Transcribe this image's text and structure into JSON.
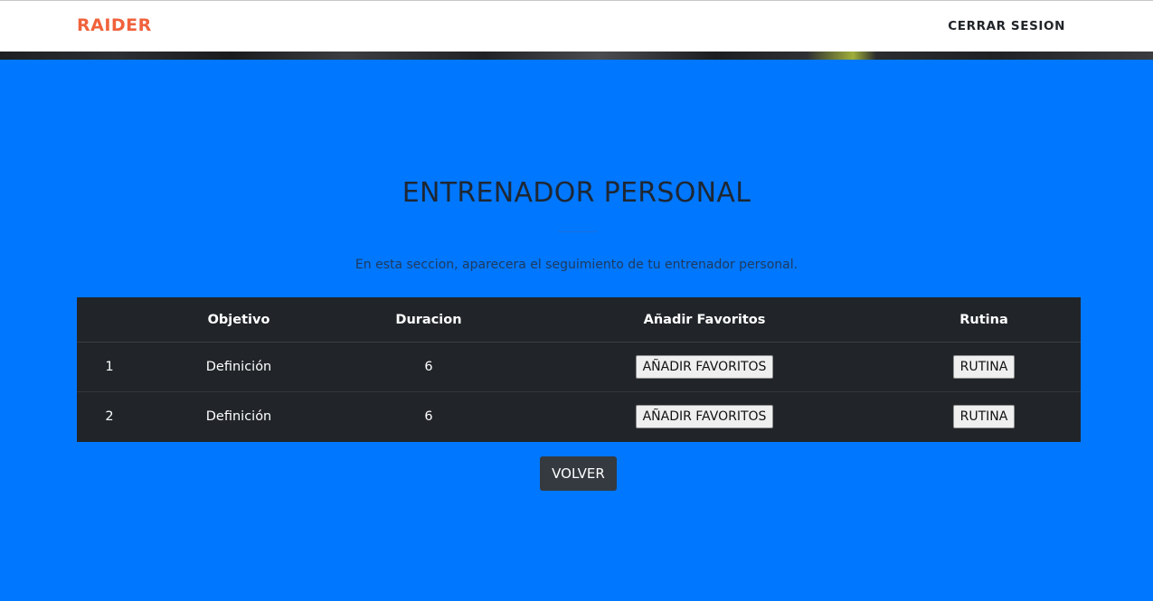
{
  "navbar": {
    "brand": "RAIDER",
    "logout_label": "CERRAR SESION"
  },
  "section": {
    "title": "ENTRENADOR PERSONAL",
    "subtitle": "En esta seccion, aparecera el seguimiento de tu entrenador personal."
  },
  "table": {
    "headers": [
      "",
      "Objetivo",
      "Duracion",
      "Añadir Favoritos",
      "Rutina"
    ],
    "rows": [
      {
        "index": "1",
        "objetivo": "Definición",
        "duracion": "6",
        "favoritos_label": "AÑADIR FAVORITOS",
        "rutina_label": "RUTINA"
      },
      {
        "index": "2",
        "objetivo": "Definición",
        "duracion": "6",
        "favoritos_label": "AÑADIR FAVORITOS",
        "rutina_label": "RUTINA"
      }
    ]
  },
  "footer": {
    "back_label": "VOLVER"
  },
  "colors": {
    "background": "#0077ff",
    "brand": "#f0623c",
    "table_bg": "#212529",
    "back_button": "#343a40"
  }
}
